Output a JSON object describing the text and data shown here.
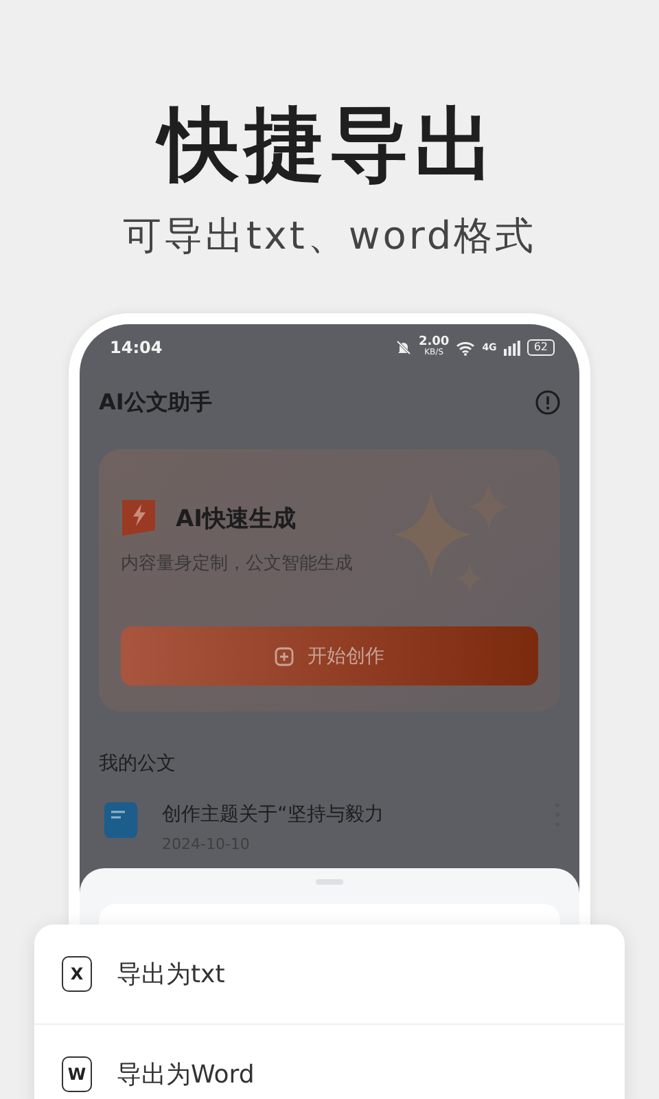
{
  "headline": "快捷导出",
  "subtitle": "可导出txt、word格式",
  "status_bar": {
    "time": "14:04",
    "speed": "2.00",
    "speed_unit": "KB/S",
    "network": "4G",
    "battery": "62"
  },
  "app_bar": {
    "title": "AI公文助手"
  },
  "hero_card": {
    "title": "AI快速生成",
    "description": "内容量身定制，公文智能生成",
    "button": "开始创作"
  },
  "section_title": "我的公文",
  "documents": [
    {
      "title": "创作主题关于“坚持与毅力",
      "date": "2024-10-10"
    }
  ],
  "export_menu": [
    {
      "icon_letter": "X",
      "label": "导出为txt"
    },
    {
      "icon_letter": "W",
      "label": "导出为Word"
    }
  ]
}
